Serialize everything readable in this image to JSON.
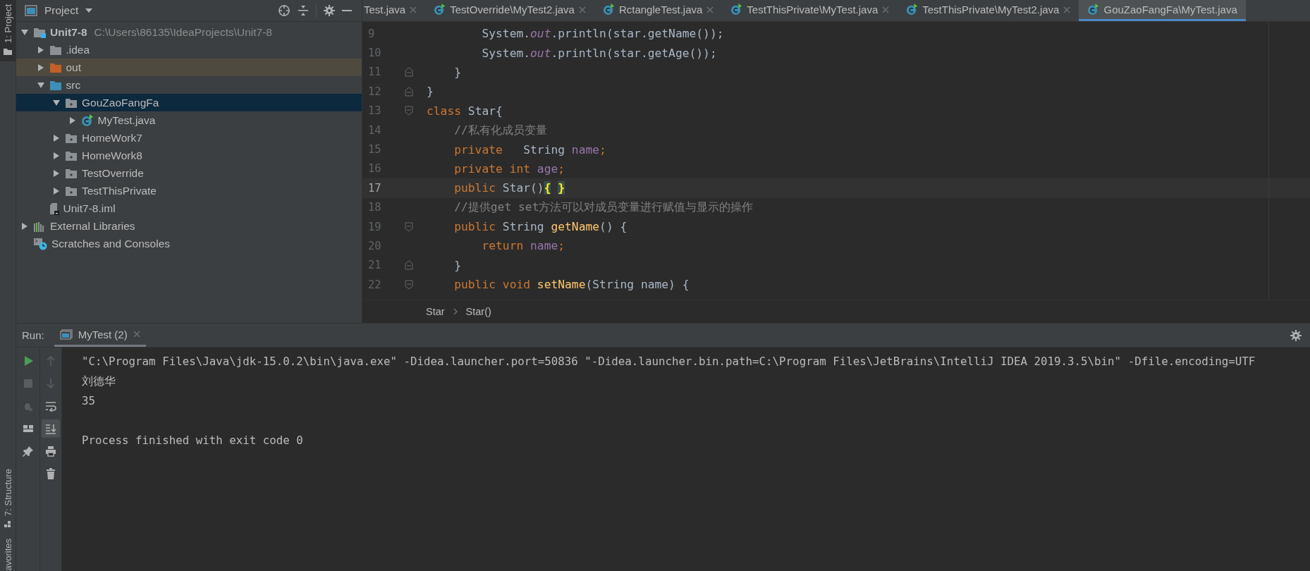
{
  "stripes": {
    "top": [
      {
        "label": "1: Project",
        "selected": true
      }
    ],
    "bottom": [
      {
        "label": "7: Structure",
        "selected": false
      },
      {
        "label": "avorites",
        "selected": false
      }
    ]
  },
  "project": {
    "title": "Project",
    "tree": [
      {
        "label": "Unit7-8",
        "path": "C:\\Users\\86135\\IdeaProjects\\Unit7-8",
        "kind": "module",
        "expanded": true,
        "selected": false,
        "children": [
          {
            "label": ".idea",
            "kind": "folder",
            "expanded": false,
            "selected": false
          },
          {
            "label": "out",
            "kind": "excluded",
            "expanded": false,
            "selected": false
          },
          {
            "label": "src",
            "kind": "source",
            "expanded": true,
            "selected": false,
            "children": [
              {
                "label": "GouZaoFangFa",
                "kind": "package",
                "expanded": true,
                "selected": true,
                "children": [
                  {
                    "label": "MyTest.java",
                    "kind": "java-class",
                    "expanded": false,
                    "selected": false
                  }
                ]
              },
              {
                "label": "HomeWork7",
                "kind": "package",
                "expanded": false,
                "selected": false
              },
              {
                "label": "HomeWork8",
                "kind": "package",
                "expanded": false,
                "selected": false
              },
              {
                "label": "TestOverride",
                "kind": "package",
                "expanded": false,
                "selected": false
              },
              {
                "label": "TestThisPrivate",
                "kind": "package",
                "expanded": false,
                "selected": false
              }
            ]
          },
          {
            "label": "Unit7-8.iml",
            "kind": "iml",
            "selected": false
          }
        ]
      },
      {
        "label": "External Libraries",
        "kind": "libraries",
        "expanded": false,
        "selected": false
      },
      {
        "label": "Scratches and Consoles",
        "kind": "scratches",
        "selected": false
      }
    ]
  },
  "tabs": [
    {
      "label": "Test.java",
      "kind": "partial",
      "selected": false,
      "close": true
    },
    {
      "label": "TestOverride\\MyTest2.java",
      "kind": "class",
      "selected": false,
      "close": true
    },
    {
      "label": "RctangleTest.java",
      "kind": "class",
      "selected": false,
      "close": true
    },
    {
      "label": "TestThisPrivate\\MyTest.java",
      "kind": "class",
      "selected": false,
      "close": true
    },
    {
      "label": "TestThisPrivate\\MyTest2.java",
      "kind": "class",
      "selected": false,
      "close": true
    },
    {
      "label": "GouZaoFangFa\\MyTest.java",
      "kind": "class",
      "selected": true,
      "close": false
    }
  ],
  "code": [
    {
      "number": "9",
      "current": false,
      "kind": "plain",
      "tokens": [
        {
          "t": "        System.",
          "kind": "plain"
        },
        {
          "t": "out",
          "kind": "static"
        },
        {
          "t": ".println(star.getName());",
          "kind": "plain"
        }
      ]
    },
    {
      "number": "10",
      "current": false,
      "kind": "plain",
      "tokens": [
        {
          "t": "        System.",
          "kind": "plain"
        },
        {
          "t": "out",
          "kind": "static"
        },
        {
          "t": ".println(star.getAge());",
          "kind": "plain"
        }
      ]
    },
    {
      "number": "11",
      "current": false,
      "kind": "fold-end",
      "tokens": [
        {
          "t": "    }",
          "kind": "plain"
        }
      ]
    },
    {
      "number": "12",
      "current": false,
      "kind": "fold-end",
      "tokens": [
        {
          "t": "}",
          "kind": "plain"
        }
      ]
    },
    {
      "number": "13",
      "current": false,
      "kind": "fold-start",
      "tokens": [
        {
          "t": "class ",
          "kind": "kw"
        },
        {
          "t": "Star{",
          "kind": "plain"
        }
      ]
    },
    {
      "number": "14",
      "current": false,
      "kind": "plain",
      "tokens": [
        {
          "t": "    //私有化成员变量",
          "kind": "comment"
        }
      ]
    },
    {
      "number": "15",
      "current": false,
      "kind": "plain",
      "tokens": [
        {
          "t": "    private",
          "kind": "kw"
        },
        {
          "t": "   String ",
          "kind": "plain"
        },
        {
          "t": "name",
          "kind": "field"
        },
        {
          "t": ";",
          "kind": "kw"
        }
      ]
    },
    {
      "number": "16",
      "current": false,
      "kind": "plain",
      "tokens": [
        {
          "t": "    private int ",
          "kind": "kw"
        },
        {
          "t": "age",
          "kind": "field"
        },
        {
          "t": ";",
          "kind": "kw"
        }
      ]
    },
    {
      "number": "17",
      "current": true,
      "kind": "plain",
      "tokens": [
        {
          "t": "    public ",
          "kind": "kw"
        },
        {
          "t": "Star()",
          "kind": "plain"
        },
        {
          "t": "{",
          "kind": "brace"
        },
        {
          "t": "}",
          "kind": "brace"
        }
      ]
    },
    {
      "number": "18",
      "current": false,
      "kind": "plain",
      "tokens": [
        {
          "t": "    //提供get set方法可以对成员变量进行赋值与显示的操作",
          "kind": "comment"
        }
      ]
    },
    {
      "number": "19",
      "current": false,
      "kind": "fold-start",
      "tokens": [
        {
          "t": "    public ",
          "kind": "kw"
        },
        {
          "t": "String ",
          "kind": "plain"
        },
        {
          "t": "getName",
          "kind": "method"
        },
        {
          "t": "() {",
          "kind": "plain"
        }
      ]
    },
    {
      "number": "20",
      "current": false,
      "kind": "plain",
      "tokens": [
        {
          "t": "        return ",
          "kind": "kw"
        },
        {
          "t": "name",
          "kind": "field"
        },
        {
          "t": ";",
          "kind": "kw"
        }
      ]
    },
    {
      "number": "21",
      "current": false,
      "kind": "fold-end",
      "tokens": [
        {
          "t": "    }",
          "kind": "plain"
        }
      ]
    },
    {
      "number": "22",
      "current": false,
      "kind": "fold-start",
      "tokens": [
        {
          "t": "    public void ",
          "kind": "kw"
        },
        {
          "t": "setName",
          "kind": "method"
        },
        {
          "t": "(String name) {",
          "kind": "plain"
        }
      ]
    }
  ],
  "breadcrumbs": [
    "Star",
    "Star()"
  ],
  "run": {
    "label": "Run:",
    "tab": {
      "label": "MyTest (2)",
      "selected": true
    },
    "tools_left": [
      {
        "kind": "run",
        "disabled": false
      },
      {
        "kind": "stop",
        "disabled": true
      },
      {
        "kind": "debug",
        "disabled": true
      },
      {
        "kind": "layout",
        "disabled": false
      },
      {
        "kind": "pin",
        "disabled": false
      }
    ],
    "tools_right": [
      {
        "kind": "up",
        "disabled": true,
        "on": false
      },
      {
        "kind": "down",
        "disabled": true,
        "on": false
      },
      {
        "kind": "wrap",
        "disabled": false,
        "on": false
      },
      {
        "kind": "scroll",
        "disabled": false,
        "on": true
      },
      {
        "kind": "print",
        "disabled": false,
        "on": false
      },
      {
        "kind": "trash",
        "disabled": false,
        "on": false
      }
    ],
    "lines": [
      "\"C:\\Program Files\\Java\\jdk-15.0.2\\bin\\java.exe\" -Didea.launcher.port=50836 \"-Didea.launcher.bin.path=C:\\Program Files\\JetBrains\\IntelliJ IDEA 2019.3.5\\bin\" -Dfile.encoding=UTF",
      "刘德华",
      "35"
    ],
    "exit_message": "Process finished with exit code 0"
  }
}
